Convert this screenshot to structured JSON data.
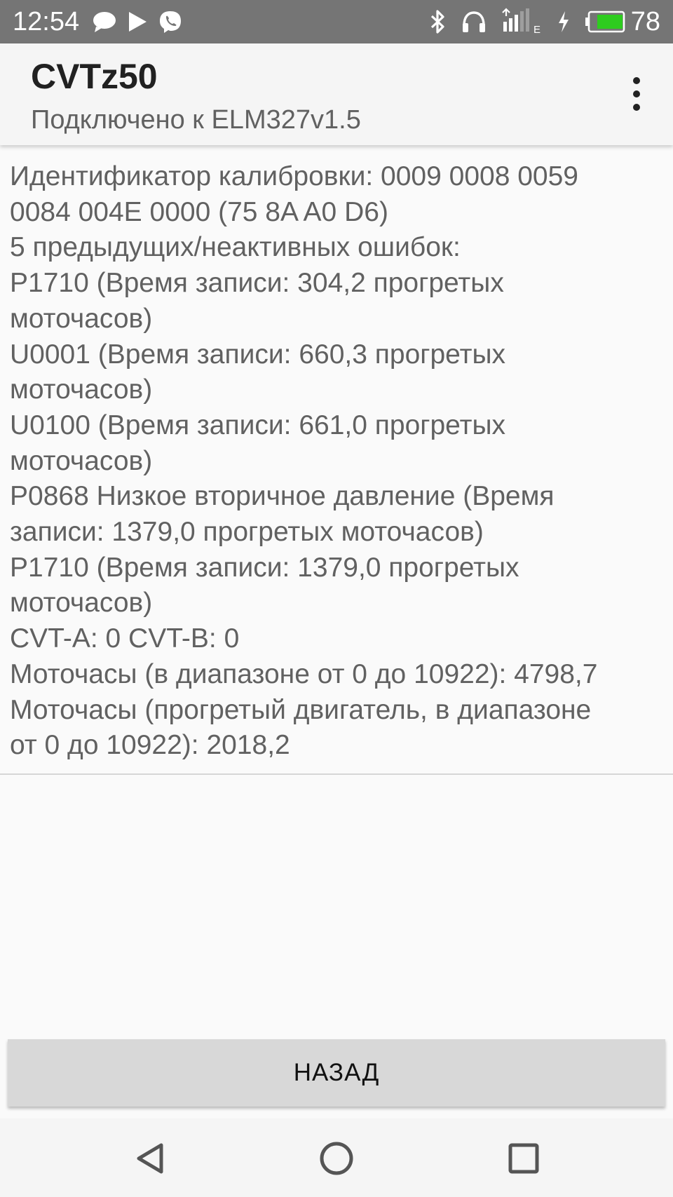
{
  "status_bar": {
    "time": "12:54",
    "left_icons": [
      "chat-bubble-icon",
      "play-icon",
      "viber-icon"
    ],
    "right_icons": [
      "bluetooth-icon",
      "headphones-icon",
      "signal-icon",
      "charging-icon",
      "battery-icon"
    ],
    "network_type": "E",
    "battery_level": "78",
    "battery_color": "#2ecc1f"
  },
  "app_bar": {
    "title": "CVTz50",
    "subtitle": "Подключено к ELM327v1.5",
    "menu_icon": "more-vert-icon"
  },
  "content": {
    "lines": [
      "Идентификатор калибровки: 0009 0008 0059",
      "0084 004E 0000  (75 8A A0 D6)",
      "5 предыдущих/неактивных ошибок:",
      "P1710  (Время записи: 304,2 прогретых",
      "моточасов)",
      "U0001  (Время записи: 660,3 прогретых",
      "моточасов)",
      "U0100  (Время записи: 661,0 прогретых",
      "моточасов)",
      "P0868 Низкое вторичное давление (Время",
      "записи: 1379,0 прогретых моточасов)",
      "P1710  (Время записи: 1379,0 прогретых",
      "моточасов)",
      "CVT-A: 0 CVT-B: 0",
      "Моточасы (в диапазоне от 0 до 10922): 4798,7",
      "Моточасы (прогретый двигатель, в диапазоне",
      "от 0 до 10922): 2018,2"
    ]
  },
  "back_button": {
    "label": "НАЗАД"
  },
  "nav_bar": {
    "buttons": [
      "back-triangle-icon",
      "home-circle-icon",
      "recents-square-icon"
    ]
  }
}
